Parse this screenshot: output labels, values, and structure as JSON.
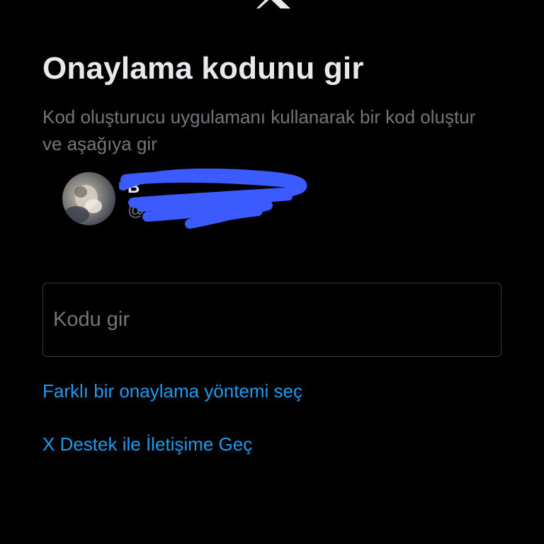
{
  "header": {
    "logo_icon": "x-logo-icon"
  },
  "title": "Onaylama kodunu gir",
  "subtitle": "Kod oluşturucu uygulamanı kullanarak bir kod oluştur ve aşağıya gir",
  "account": {
    "avatar_icon": "user-avatar",
    "display_name": "B",
    "handle": "@B",
    "redaction_color": "#3b5bff"
  },
  "code_input": {
    "placeholder": "Kodu gir",
    "value": ""
  },
  "links": {
    "different_method": "Farklı bir onaylama yöntemi seç",
    "contact_support": "X Destek ile İletişime Geç"
  },
  "colors": {
    "background": "#000000",
    "title_text": "#e7e9ea",
    "secondary_text": "#71767b",
    "link": "#1d9bf0",
    "input_border": "#333639"
  }
}
